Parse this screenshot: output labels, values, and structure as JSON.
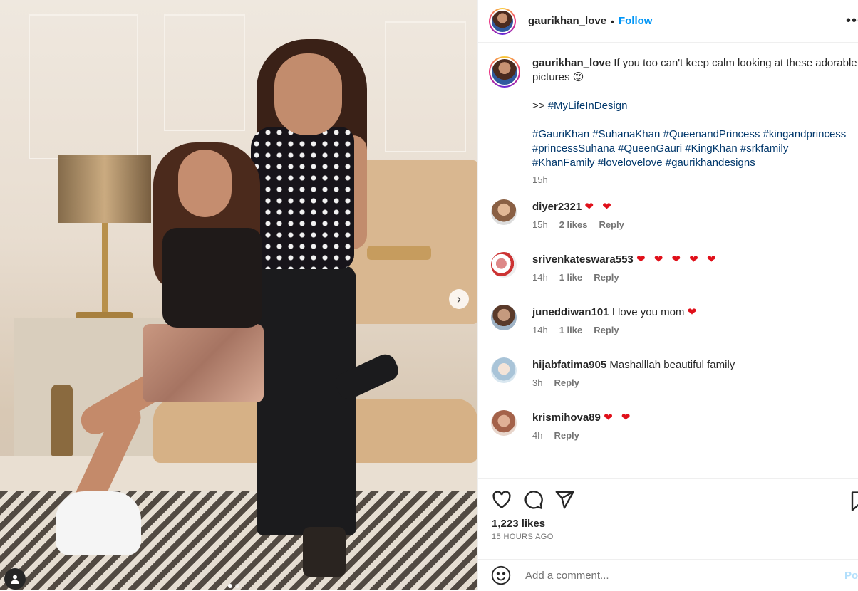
{
  "post": {
    "username": "gaurikhan_love",
    "follow_label": "Follow",
    "separator": "•",
    "caption": {
      "username": "gaurikhan_love",
      "text": "If you too can't keep calm looking at these adorable pictures 😍",
      "arrow": ">>",
      "hashtag_main": "#MyLifeInDesign",
      "hashtags_line1": "#GauriKhan #SuhanaKhan #QueenandPrincess #kingandprincess",
      "hashtags_line2": "#princessSuhana #QueenGauri #KingKhan #srkfamily",
      "hashtags_line3": "#KhanFamily #lovelovelove #gaurikhandesigns",
      "time": "15h"
    },
    "comments": [
      {
        "user": "diyer2321",
        "text": "",
        "hearts": "❤ ❤",
        "time": "15h",
        "likes": "2 likes",
        "reply": "Reply",
        "avatar_color": "#c9a27e"
      },
      {
        "user": "srivenkateswara553",
        "text": "",
        "hearts": "❤ ❤ ❤ ❤ ❤",
        "time": "14h",
        "likes": "1 like",
        "reply": "Reply",
        "avatar_color": "#b65a5a"
      },
      {
        "user": "juneddiwan101",
        "text": "I love you mom",
        "hearts": "❤",
        "time": "14h",
        "likes": "1 like",
        "reply": "Reply",
        "avatar_color": "#8c6e5a"
      },
      {
        "user": "hijabfatima905",
        "text": "Mashalllah beautiful family",
        "hearts": "",
        "time": "3h",
        "likes": "",
        "reply": "Reply",
        "avatar_color": "#a9c4d8"
      },
      {
        "user": "krismihova89",
        "text": "",
        "hearts": "❤ ❤",
        "time": "4h",
        "likes": "",
        "reply": "Reply",
        "avatar_color": "#c28a72"
      }
    ],
    "likes": "1,223 likes",
    "posted_ago": "15 HOURS AGO",
    "comment_placeholder": "Add a comment...",
    "post_label": "Post"
  },
  "colors": {
    "link": "#0095f6",
    "hashtag": "#00376b",
    "heart": "#e0101a"
  },
  "icons": [
    "more-icon",
    "heart-icon",
    "comment-icon",
    "share-icon",
    "bookmark-icon",
    "emoji-icon",
    "chevron-right-icon",
    "user-icon"
  ]
}
